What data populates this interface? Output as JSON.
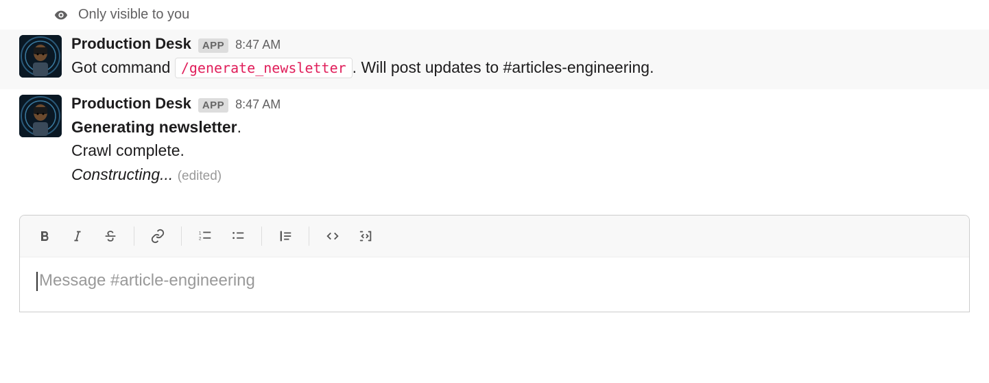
{
  "visibility": {
    "text": "Only visible to you"
  },
  "messages": [
    {
      "sender": "Production Desk",
      "badge": "APP",
      "time": "8:47 AM",
      "body_prefix": "Got command ",
      "code": "/generate_newsletter",
      "body_suffix": ". Will post updates to #articles-engineering."
    },
    {
      "sender": "Production Desk",
      "badge": "APP",
      "time": "8:47 AM",
      "line1_bold": "Generating newsletter",
      "line1_tail": ".",
      "line2": "Crawl complete.",
      "line3_italic": "Constructing...",
      "edited": "(edited)"
    }
  ],
  "composer": {
    "placeholder": "Message #article-engineering"
  }
}
